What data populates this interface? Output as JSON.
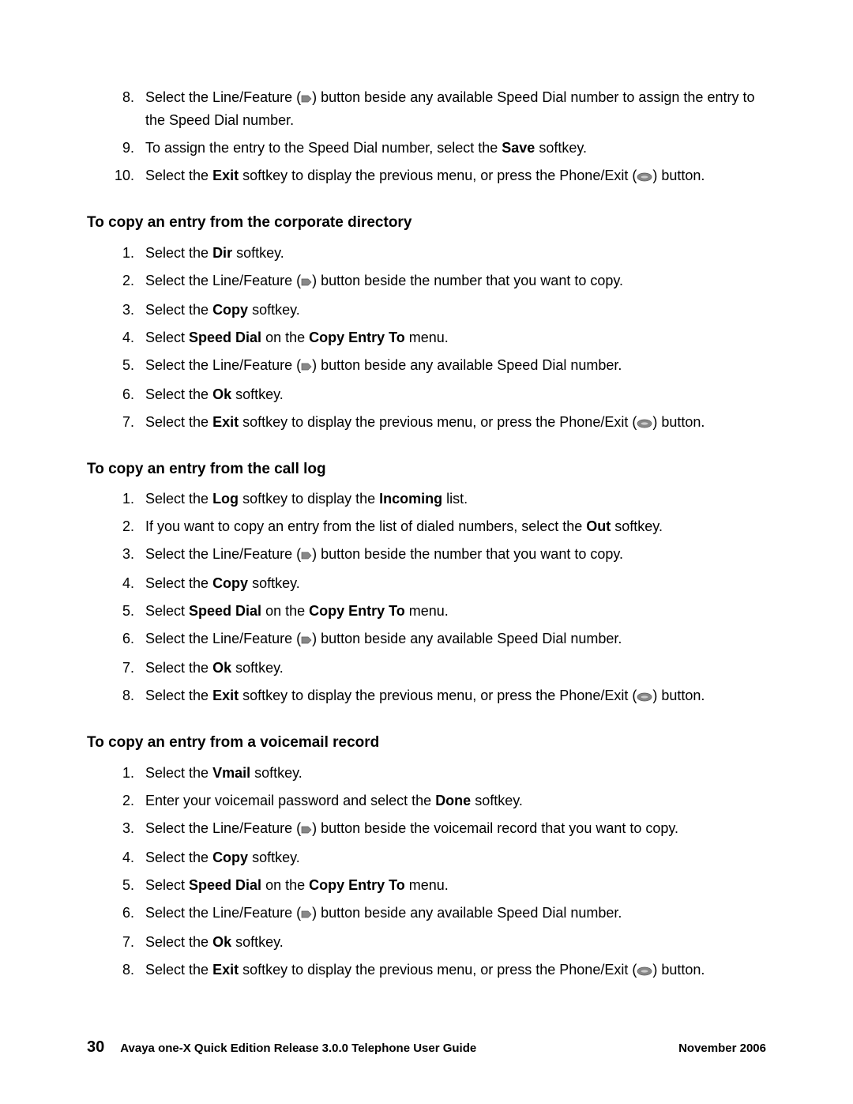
{
  "icons": {
    "line_feature": "line-feature-icon",
    "phone_exit": "phone-exit-icon"
  },
  "intro_list": {
    "start": 8,
    "items": [
      {
        "segments": [
          {
            "t": "Select the Line/Feature ("
          },
          {
            "icon": "lf"
          },
          {
            "t": ") button beside any available Speed Dial number to assign the entry to the Speed Dial number."
          }
        ]
      },
      {
        "segments": [
          {
            "t": "To assign the entry to the Speed Dial number, select the "
          },
          {
            "t": "Save",
            "b": true
          },
          {
            "t": " softkey."
          }
        ]
      },
      {
        "segments": [
          {
            "t": "Select the "
          },
          {
            "t": "Exit",
            "b": true
          },
          {
            "t": " softkey to display the previous menu, or press the Phone/Exit ("
          },
          {
            "icon": "pe"
          },
          {
            "t": ") button."
          }
        ]
      }
    ]
  },
  "sections": [
    {
      "heading": "To copy an entry from the corporate directory",
      "start": 1,
      "items": [
        {
          "segments": [
            {
              "t": "Select the "
            },
            {
              "t": "Dir",
              "b": true
            },
            {
              "t": " softkey."
            }
          ]
        },
        {
          "segments": [
            {
              "t": "Select the Line/Feature ("
            },
            {
              "icon": "lf"
            },
            {
              "t": ") button beside the number that you want to copy."
            }
          ]
        },
        {
          "segments": [
            {
              "t": "Select the "
            },
            {
              "t": "Copy",
              "b": true
            },
            {
              "t": " softkey."
            }
          ]
        },
        {
          "segments": [
            {
              "t": "Select "
            },
            {
              "t": "Speed Dial",
              "b": true
            },
            {
              "t": " on the "
            },
            {
              "t": "Copy Entry To",
              "b": true
            },
            {
              "t": " menu."
            }
          ]
        },
        {
          "segments": [
            {
              "t": "Select the Line/Feature ("
            },
            {
              "icon": "lf"
            },
            {
              "t": ") button beside any available Speed Dial number."
            }
          ]
        },
        {
          "segments": [
            {
              "t": "Select the "
            },
            {
              "t": "Ok",
              "b": true
            },
            {
              "t": " softkey."
            }
          ]
        },
        {
          "segments": [
            {
              "t": "Select the "
            },
            {
              "t": "Exit",
              "b": true
            },
            {
              "t": " softkey to display the previous menu, or press the Phone/Exit ("
            },
            {
              "icon": "pe"
            },
            {
              "t": ") button."
            }
          ]
        }
      ]
    },
    {
      "heading": "To copy an entry from the call log",
      "start": 1,
      "items": [
        {
          "segments": [
            {
              "t": "Select the "
            },
            {
              "t": "Log",
              "b": true
            },
            {
              "t": " softkey to display the "
            },
            {
              "t": "Incoming",
              "b": true
            },
            {
              "t": " list."
            }
          ]
        },
        {
          "segments": [
            {
              "t": "If you want to copy an entry from the list of dialed numbers, select the "
            },
            {
              "t": "Out",
              "b": true
            },
            {
              "t": " softkey."
            }
          ]
        },
        {
          "segments": [
            {
              "t": "Select the Line/Feature ("
            },
            {
              "icon": "lf"
            },
            {
              "t": ") button beside the number that you want to copy."
            }
          ]
        },
        {
          "segments": [
            {
              "t": "Select the "
            },
            {
              "t": "Copy",
              "b": true
            },
            {
              "t": " softkey."
            }
          ]
        },
        {
          "segments": [
            {
              "t": "Select "
            },
            {
              "t": "Speed Dial",
              "b": true
            },
            {
              "t": " on the "
            },
            {
              "t": "Copy Entry To",
              "b": true
            },
            {
              "t": " menu."
            }
          ]
        },
        {
          "segments": [
            {
              "t": "Select the Line/Feature ("
            },
            {
              "icon": "lf"
            },
            {
              "t": ") button beside any available Speed Dial number."
            }
          ]
        },
        {
          "segments": [
            {
              "t": "Select the "
            },
            {
              "t": "Ok",
              "b": true
            },
            {
              "t": " softkey."
            }
          ]
        },
        {
          "segments": [
            {
              "t": "Select the "
            },
            {
              "t": "Exit",
              "b": true
            },
            {
              "t": " softkey to display the previous menu, or press the Phone/Exit ("
            },
            {
              "icon": "pe"
            },
            {
              "t": ") button."
            }
          ]
        }
      ]
    },
    {
      "heading": "To copy an entry from a voicemail record",
      "start": 1,
      "items": [
        {
          "segments": [
            {
              "t": "Select the "
            },
            {
              "t": "Vmail",
              "b": true
            },
            {
              "t": " softkey."
            }
          ]
        },
        {
          "segments": [
            {
              "t": "Enter your voicemail password and select the "
            },
            {
              "t": "Done",
              "b": true
            },
            {
              "t": " softkey."
            }
          ]
        },
        {
          "segments": [
            {
              "t": "Select the Line/Feature ("
            },
            {
              "icon": "lf"
            },
            {
              "t": ") button beside the voicemail record that you want to copy."
            }
          ]
        },
        {
          "segments": [
            {
              "t": "Select the "
            },
            {
              "t": "Copy",
              "b": true
            },
            {
              "t": " softkey."
            }
          ]
        },
        {
          "segments": [
            {
              "t": "Select "
            },
            {
              "t": "Speed Dial",
              "b": true
            },
            {
              "t": " on the "
            },
            {
              "t": "Copy Entry To",
              "b": true
            },
            {
              "t": " menu."
            }
          ]
        },
        {
          "segments": [
            {
              "t": "Select the Line/Feature ("
            },
            {
              "icon": "lf"
            },
            {
              "t": ") button beside any available Speed Dial number."
            }
          ]
        },
        {
          "segments": [
            {
              "t": "Select the "
            },
            {
              "t": "Ok",
              "b": true
            },
            {
              "t": " softkey."
            }
          ]
        },
        {
          "segments": [
            {
              "t": "Select the "
            },
            {
              "t": "Exit",
              "b": true
            },
            {
              "t": " softkey to display the previous menu, or press the Phone/Exit ("
            },
            {
              "icon": "pe"
            },
            {
              "t": ") button."
            }
          ]
        }
      ]
    }
  ],
  "footer": {
    "page_number": "30",
    "title": "Avaya one-X Quick Edition Release 3.0.0 Telephone User Guide",
    "date": "November 2006"
  }
}
